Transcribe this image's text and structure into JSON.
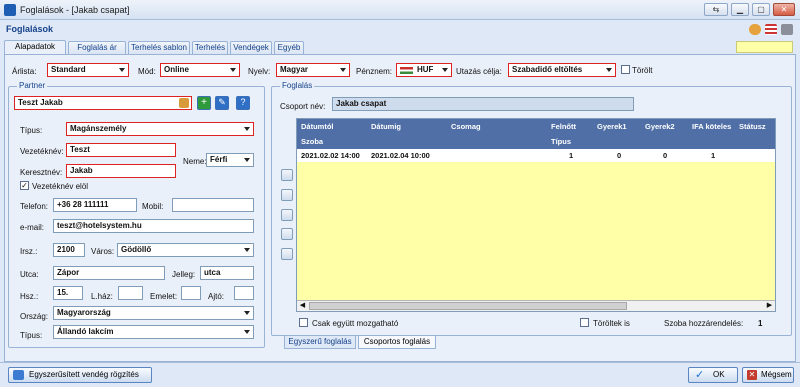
{
  "window": {
    "title": "Foglalások - [Jakab csapat]",
    "header_title": "Foglalások"
  },
  "tabs": [
    {
      "label": "Alapadatok",
      "active": true
    },
    {
      "label": "Foglalás ár"
    },
    {
      "label": "Terhelés sablon"
    },
    {
      "label": "Terhelés"
    },
    {
      "label": "Vendégek"
    },
    {
      "label": "Egyéb"
    }
  ],
  "topbar": {
    "arlista_label": "Árlista:",
    "arlista_value": "Standard",
    "mod_label": "Mód:",
    "mod_value": "Online",
    "nyelv_label": "Nyelv:",
    "nyelv_value": "Magyar",
    "penznem_label": "Pénznem:",
    "penznem_value": "HUF",
    "utazas_label": "Utazás célja:",
    "utazas_value": "Szabadidő eltöltés",
    "torolt_label": "Törölt"
  },
  "partner": {
    "group_title": "Partner",
    "name_value": "Teszt Jakab",
    "tipus_label": "Típus:",
    "tipus_value": "Magánszemély",
    "vezeteknev_label": "Vezetéknév:",
    "vezeteknev_value": "Teszt",
    "nem_label": "Neme:",
    "nem_value": "Férfi",
    "keresztnev_label": "Keresztnév:",
    "keresztnev_value": "Jakab",
    "vezeteknev_elol_label": "Vezetéknév elöl",
    "telefon_label": "Telefon:",
    "telefon_value": "+36 28 111111",
    "mobil_label": "Mobil:",
    "mobil_value": "",
    "email_label": "e-mail:",
    "email_value": "teszt@hotelsystem.hu",
    "irsz_label": "Irsz.:",
    "irsz_value": "2100",
    "varos_label": "Város:",
    "varos_value": "Gödöllő",
    "utca_label": "Utca:",
    "utca_value": "Zápor",
    "jelleg_label": "Jelleg:",
    "jelleg_value": "utca",
    "hsz_label": "Hsz.:",
    "hsz_value": "15.",
    "lhaz_label": "L.ház:",
    "emelet_label": "Emelet:",
    "ajto_label": "Ajtó:",
    "orszag_label": "Ország:",
    "orszag_value": "Magyarország",
    "tipus2_label": "Típus:",
    "tipus2_value": "Állandó lakcím"
  },
  "foglalas": {
    "group_title": "Foglalás",
    "csoport_label": "Csoport név:",
    "csoport_value": "Jakab csapat",
    "columns": [
      "Dátumtól",
      "Dátumig",
      "Csomag",
      "Felnőtt",
      "Gyerek1",
      "Gyerek2",
      "IFA köteles",
      "Státusz"
    ],
    "subcolumns": [
      "Szoba",
      "Típus"
    ],
    "rows": [
      {
        "datumtol": "2021.02.02 14:00",
        "datumig": "2021.02.04 10:00",
        "csomag": "",
        "felnott": "1",
        "gyerek1": "0",
        "gyerek2": "0",
        "ifa": "1",
        "statusz": ""
      }
    ],
    "csak_egyutt_label": "Csak együtt mozgatható",
    "toroltek_is_label": "Töröltek is",
    "szoba_hozzarendeles_label": "Szoba hozzárendelés:",
    "szoba_hozzarendeles_value": "1",
    "subtabs": [
      "Egyszerű foglalás",
      "Csoportos foglalás"
    ]
  },
  "bottom": {
    "egyszerusitett_label": "Egyszerűsített vendég rögzítés",
    "ok_label": "OK",
    "megsem_label": "Mégsem"
  },
  "colors": {
    "accent": "#15428b",
    "grid_header": "#4f6fa6",
    "grid_bg": "#ffffa8",
    "required_border": "#dd2222"
  }
}
